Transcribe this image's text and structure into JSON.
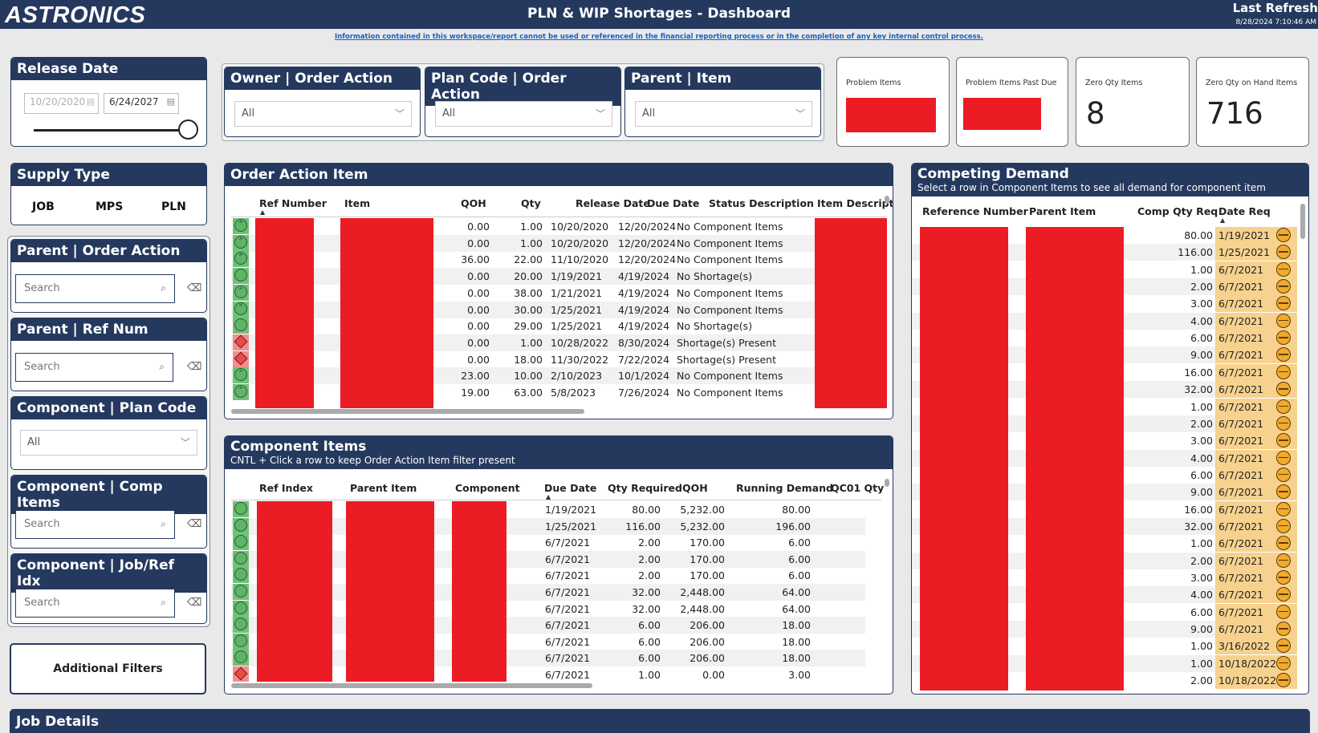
{
  "header": {
    "logo": "ASTRONICS",
    "title": "PLN & WIP Shortages - Dashboard",
    "last_refresh_label": "Last Refresh",
    "last_refresh_time": "8/28/2024 7:10:46 AM",
    "disclaimer": "Information contained in this workspace/report cannot be used or referenced in the financial reporting process or in the completion of any key internal control process."
  },
  "release_date": {
    "title": "Release Date",
    "start": "10/20/2020",
    "end": "6/24/2027",
    "slider_position": 1.0
  },
  "filters": {
    "owner": {
      "title": "Owner | Order Action",
      "value": "All"
    },
    "plan_code": {
      "title": "Plan Code | Order Action",
      "value": "All"
    },
    "parent_item": {
      "title": "Parent | Item",
      "value": "All"
    }
  },
  "kpis": {
    "problem_items": {
      "label": "Problem Items"
    },
    "problem_items_past_due": {
      "label": "Problem Items Past Due"
    },
    "zero_qty_items": {
      "label": "Zero Qty Items",
      "value": "8"
    },
    "zero_qty_on_hand": {
      "label": "Zero Qty on Hand Items",
      "value": "716"
    }
  },
  "supply_type": {
    "title": "Supply Type",
    "options": [
      "JOB",
      "MPS",
      "PLN"
    ]
  },
  "side_filters": {
    "parent_order_action": {
      "title": "Parent | Order Action",
      "placeholder": "Search"
    },
    "parent_ref_num": {
      "title": "Parent | Ref Num",
      "placeholder": "Search"
    },
    "component_plan_code": {
      "title": "Component | Plan Code",
      "value": "All"
    },
    "component_comp_items": {
      "title": "Component | Comp Items",
      "placeholder": "Search"
    },
    "component_job_ref_idx": {
      "title": "Component | Job/Ref Idx",
      "placeholder": "Search"
    },
    "additional_filters": "Additional Filters"
  },
  "order_action_item": {
    "title": "Order Action Item",
    "columns": [
      "Ref Number",
      "Item",
      "QOH",
      "Qty",
      "Release Date",
      "Due Date",
      "Status Description",
      "Item Descript"
    ],
    "rows": [
      {
        "status": "up",
        "qoh": "0.00",
        "qty": "1.00",
        "release": "10/20/2020",
        "due": "12/20/2024",
        "desc": "No Component Items"
      },
      {
        "status": "up",
        "qoh": "0.00",
        "qty": "1.00",
        "release": "10/20/2020",
        "due": "12/20/2024",
        "desc": "No Component Items"
      },
      {
        "status": "up",
        "qoh": "36.00",
        "qty": "22.00",
        "release": "11/10/2020",
        "due": "12/20/2024",
        "desc": "No Component Items"
      },
      {
        "status": "ok",
        "qoh": "0.00",
        "qty": "20.00",
        "release": "1/19/2021",
        "due": "4/19/2024",
        "desc": "No Shortage(s)"
      },
      {
        "status": "up",
        "qoh": "0.00",
        "qty": "38.00",
        "release": "1/21/2021",
        "due": "4/19/2024",
        "desc": "No Component Items"
      },
      {
        "status": "up",
        "qoh": "0.00",
        "qty": "30.00",
        "release": "1/25/2021",
        "due": "4/19/2024",
        "desc": "No Component Items"
      },
      {
        "status": "ok",
        "qoh": "0.00",
        "qty": "29.00",
        "release": "1/25/2021",
        "due": "4/19/2024",
        "desc": "No Shortage(s)"
      },
      {
        "status": "bad",
        "qoh": "0.00",
        "qty": "1.00",
        "release": "10/28/2022",
        "due": "8/30/2024",
        "desc": "Shortage(s) Present"
      },
      {
        "status": "bad",
        "qoh": "0.00",
        "qty": "18.00",
        "release": "11/30/2022",
        "due": "7/22/2024",
        "desc": "Shortage(s) Present"
      },
      {
        "status": "up",
        "qoh": "23.00",
        "qty": "10.00",
        "release": "2/10/2023",
        "due": "10/1/2024",
        "desc": "No Component Items"
      },
      {
        "status": "up",
        "qoh": "19.00",
        "qty": "63.00",
        "release": "5/8/2023",
        "due": "7/26/2024",
        "desc": "No Component Items"
      }
    ]
  },
  "component_items": {
    "title": "Component Items",
    "subtitle": "CNTL + Click a row to keep Order Action Item filter present",
    "columns": [
      "Ref Index",
      "Parent Item",
      "Component",
      "Due Date",
      "Qty Required",
      "QOH",
      "Running Demand",
      "QC01 Qty"
    ],
    "rows": [
      {
        "status": "ok",
        "due": "1/19/2021",
        "qty": "80.00",
        "qoh": "5,232.00",
        "running": "80.00"
      },
      {
        "status": "ok",
        "due": "1/25/2021",
        "qty": "116.00",
        "qoh": "5,232.00",
        "running": "196.00"
      },
      {
        "status": "ok",
        "due": "6/7/2021",
        "qty": "2.00",
        "qoh": "170.00",
        "running": "6.00"
      },
      {
        "status": "ok",
        "due": "6/7/2021",
        "qty": "2.00",
        "qoh": "170.00",
        "running": "6.00"
      },
      {
        "status": "ok",
        "due": "6/7/2021",
        "qty": "2.00",
        "qoh": "170.00",
        "running": "6.00"
      },
      {
        "status": "ok",
        "due": "6/7/2021",
        "qty": "32.00",
        "qoh": "2,448.00",
        "running": "64.00"
      },
      {
        "status": "ok",
        "due": "6/7/2021",
        "qty": "32.00",
        "qoh": "2,448.00",
        "running": "64.00"
      },
      {
        "status": "ok",
        "due": "6/7/2021",
        "qty": "6.00",
        "qoh": "206.00",
        "running": "18.00"
      },
      {
        "status": "ok",
        "due": "6/7/2021",
        "qty": "6.00",
        "qoh": "206.00",
        "running": "18.00"
      },
      {
        "status": "ok",
        "due": "6/7/2021",
        "qty": "6.00",
        "qoh": "206.00",
        "running": "18.00"
      },
      {
        "status": "bad",
        "due": "6/7/2021",
        "qty": "1.00",
        "qoh": "0.00",
        "running": "3.00"
      }
    ]
  },
  "competing_demand": {
    "title": "Competing Demand",
    "subtitle": "Select a row in Component Items to see all demand for component item",
    "columns": [
      "Reference Number",
      "Parent Item",
      "Comp Qty Req",
      "Date Req"
    ],
    "rows": [
      {
        "qty": "80.00",
        "date": "1/19/2021"
      },
      {
        "qty": "116.00",
        "date": "1/25/2021"
      },
      {
        "qty": "1.00",
        "date": "6/7/2021"
      },
      {
        "qty": "2.00",
        "date": "6/7/2021"
      },
      {
        "qty": "3.00",
        "date": "6/7/2021"
      },
      {
        "qty": "4.00",
        "date": "6/7/2021"
      },
      {
        "qty": "6.00",
        "date": "6/7/2021"
      },
      {
        "qty": "9.00",
        "date": "6/7/2021"
      },
      {
        "qty": "16.00",
        "date": "6/7/2021"
      },
      {
        "qty": "32.00",
        "date": "6/7/2021"
      },
      {
        "qty": "1.00",
        "date": "6/7/2021"
      },
      {
        "qty": "2.00",
        "date": "6/7/2021"
      },
      {
        "qty": "3.00",
        "date": "6/7/2021"
      },
      {
        "qty": "4.00",
        "date": "6/7/2021"
      },
      {
        "qty": "6.00",
        "date": "6/7/2021"
      },
      {
        "qty": "9.00",
        "date": "6/7/2021"
      },
      {
        "qty": "16.00",
        "date": "6/7/2021"
      },
      {
        "qty": "32.00",
        "date": "6/7/2021"
      },
      {
        "qty": "1.00",
        "date": "6/7/2021"
      },
      {
        "qty": "2.00",
        "date": "6/7/2021"
      },
      {
        "qty": "3.00",
        "date": "6/7/2021"
      },
      {
        "qty": "4.00",
        "date": "6/7/2021"
      },
      {
        "qty": "6.00",
        "date": "6/7/2021"
      },
      {
        "qty": "9.00",
        "date": "6/7/2021"
      },
      {
        "qty": "1.00",
        "date": "3/16/2022"
      },
      {
        "qty": "1.00",
        "date": "10/18/2022"
      },
      {
        "qty": "2.00",
        "date": "10/18/2022"
      }
    ]
  },
  "job_details": {
    "title": "Job Details"
  },
  "colors": {
    "navy": "#25395f",
    "redacted": "#ec1c24",
    "good": "#5db565",
    "bad": "#e84b4b",
    "warn": "#f2aa2d",
    "date_highlight": "#f6d28e"
  }
}
